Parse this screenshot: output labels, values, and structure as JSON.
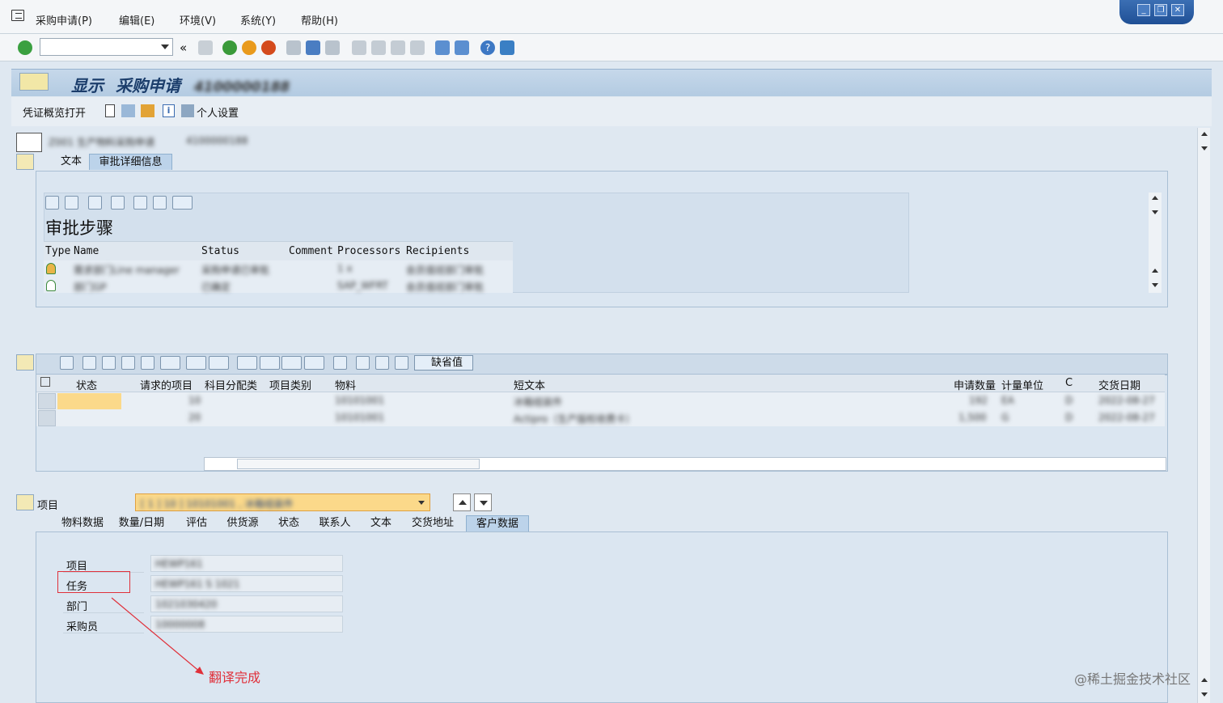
{
  "menu": [
    "采购申请(P)",
    "编辑(E)",
    "环境(V)",
    "系统(Y)",
    "帮助(H)"
  ],
  "window_controls": [
    "_",
    "❐",
    "✕"
  ],
  "title": {
    "action": "显示",
    "object": "采购申请",
    "doc_number": "4100000188"
  },
  "app_toolbar": {
    "overview_button": "凭证概览打开",
    "personal_settings": "个人设置"
  },
  "header": {
    "doc_type": "Z001 生产物料采购申请",
    "doc_ref": "4100000188"
  },
  "header_tabs": [
    "文本",
    "审批详细信息"
  ],
  "approval": {
    "heading": "审批步骤",
    "columns": [
      "Type",
      "Name",
      "Status",
      "Comment",
      "Processors",
      "Recipients"
    ],
    "rows": [
      {
        "name": "需求部门Line manager",
        "status": "采购申请已审批",
        "processors": "1 x",
        "recipients": "会员值班部门审批"
      },
      {
        "name": "部门GP",
        "status": "已确定",
        "processors": "SAP_WFRT",
        "recipients": "会员值班部门审批"
      }
    ]
  },
  "item_toolbar": {
    "default_values_button": "缺省值"
  },
  "items_grid": {
    "columns": [
      "状态",
      "请求的项目",
      "科目分配类",
      "项目类别",
      "物料",
      "短文本",
      "申请数量",
      "计量单位",
      "C",
      "交货日期"
    ],
    "rows": [
      {
        "item": "10",
        "material": "10101001",
        "short_text": "冰箱组装件",
        "qty": "192",
        "unit": "EA",
        "c": "D",
        "date": "2022-08-27"
      },
      {
        "item": "20",
        "material": "10101001",
        "short_text": "Actipro（生产版权收费卡）",
        "qty": "1,500",
        "unit": "G",
        "c": "D",
        "date": "2022-08-27"
      }
    ]
  },
  "item_section": {
    "label": "项目",
    "selector_value": "[ 1 ] 10 ] 10101001 , 冰箱组装件"
  },
  "item_tabs": [
    "物料数据",
    "数量/日期",
    "评估",
    "供货源",
    "状态",
    "联系人",
    "文本",
    "交货地址",
    "客户数据"
  ],
  "customer_fields": [
    {
      "label": "项目",
      "value": "HEWP161"
    },
    {
      "label": "任务",
      "value": "HEWP161 S 1021"
    },
    {
      "label": "部门",
      "value": "1021030420"
    },
    {
      "label": "采购员",
      "value": "10000008"
    }
  ],
  "annotation": {
    "text": "翻译完成",
    "color": "#e0303a"
  },
  "watermark_text": "@稀土掘金技术社区",
  "colors": {
    "accent": "#1b3d6b",
    "highlight_cell": "#fbd98a",
    "annotation": "#e0303a"
  }
}
